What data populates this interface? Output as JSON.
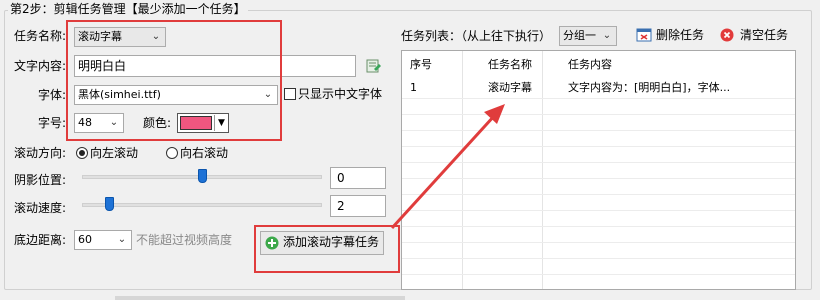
{
  "step_title": "第2步：剪辑任务管理【最少添加一个任务】",
  "left": {
    "task_name_label": "任务名称:",
    "task_name_value": "滚动字幕",
    "text_content_label": "文字内容:",
    "text_content_value": "明明白白",
    "font_label": "字体:",
    "font_value": "黑体(simhei.ttf)",
    "only_chinese_label": "只显示中文字体",
    "size_label": "字号:",
    "size_value": "48",
    "color_label": "颜色:",
    "color_value": "#f0567f",
    "direction_label": "滚动方向:",
    "direction_left": "向左滚动",
    "direction_right": "向右滚动",
    "shadow_label": "阴影位置:",
    "shadow_value": "0",
    "shadow_level": 0.5,
    "speed_label": "滚动速度:",
    "speed_value": "2",
    "speed_level": 0.1,
    "bottom_label": "底边距离:",
    "bottom_value": "60",
    "bottom_hint": "不能超过视频高度",
    "add_button": "添加滚动字幕任务"
  },
  "right": {
    "task_list_label": "任务列表：（从上往下执行）",
    "group_value": "分组一",
    "delete_button": "删除任务",
    "clear_button": "清空任务",
    "columns": [
      "序号",
      "任务名称",
      "任务内容"
    ],
    "rows": [
      [
        "1",
        "滚动字幕",
        "文字内容为：[明明白白]，字体..."
      ]
    ]
  },
  "colors": {
    "highlight": "#e03c3c",
    "accent": "#1e72d6"
  }
}
